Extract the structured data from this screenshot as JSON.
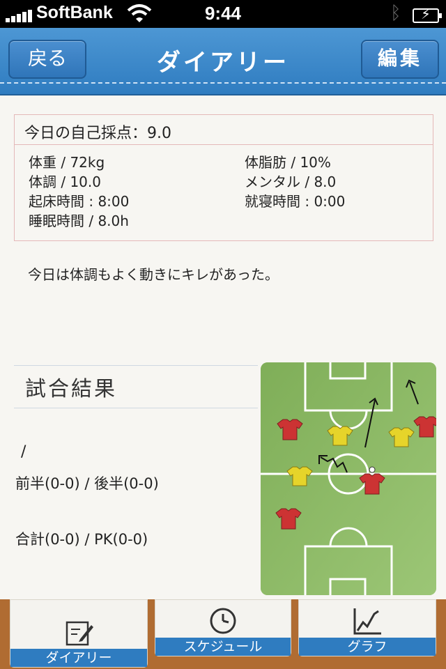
{
  "status_bar": {
    "carrier": "SoftBank",
    "time": "9:44"
  },
  "nav": {
    "back_label": "戻る",
    "title": "ダイアリー",
    "edit_label": "編集"
  },
  "score": {
    "header": "今日の自己採点：9.0",
    "metrics": {
      "weight": "体重 / 72kg",
      "body_fat": "体脂肪 / 10%",
      "condition": "体調 / 10.0",
      "mental": "メンタル / 8.0",
      "wake_time": "起床時間 : 8:00",
      "sleep_time": "就寝時間 : 0:00",
      "sleep_hours": "睡眠時間 / 8.0h"
    }
  },
  "memo": "今日は体調もよく動きにキレがあった。",
  "match": {
    "title": "試合結果",
    "opponent": "/",
    "halves": "前半(0-0) / 後半(0-0)",
    "total": "合計(0-0) / PK(0-0)"
  },
  "tabs": [
    {
      "label": "ダイアリー",
      "icon": "diary-icon"
    },
    {
      "label": "スケジュール",
      "icon": "clock-icon"
    },
    {
      "label": "グラフ",
      "icon": "chart-icon"
    }
  ],
  "colors": {
    "nav_blue": "#3a86c9",
    "tab_brown": "#b06c32",
    "pitch_green": "#8ab663"
  }
}
